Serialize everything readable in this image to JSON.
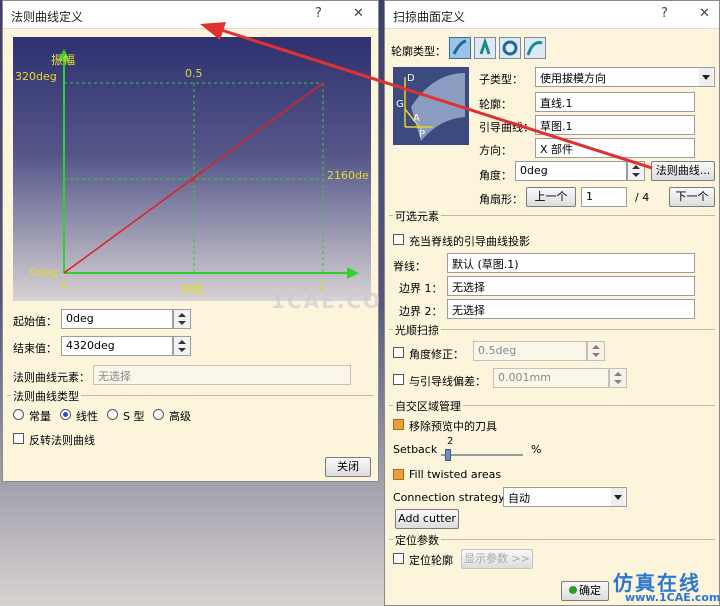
{
  "law": {
    "title": "法则曲线定义",
    "help": "?",
    "close": "✕",
    "graph": {
      "y_axis": "振幅",
      "y_max": "320deg",
      "y_min": "0deg",
      "x_mid": "0.5",
      "mid_right": "2160de",
      "x_min": "0",
      "x_label": "参数",
      "x_max": "1",
      "watermark": "1CAE.CO"
    },
    "start_label": "起始值：",
    "start_value": "0deg",
    "end_label": "结束值：",
    "end_value": "4320deg",
    "element_label": "法则曲线元素：",
    "element_value": "无选择",
    "type_section": "法则曲线类型",
    "types": [
      {
        "label": "常量",
        "checked": false
      },
      {
        "label": "线性",
        "checked": true
      },
      {
        "label": "S 型",
        "checked": false
      },
      {
        "label": "高级",
        "checked": false
      }
    ],
    "reverse_label": "反转法则曲线",
    "close_label": "关闭"
  },
  "sweep": {
    "title": "扫掠曲面定义",
    "help": "?",
    "close": "✕",
    "profile_type_label": "轮廓类型：",
    "icons": [
      "sweep-explicit-icon",
      "sweep-line-icon",
      "sweep-circle-icon",
      "sweep-conic-icon"
    ],
    "diagram": {
      "d": "D",
      "g": "G",
      "a": "A",
      "p": "P"
    },
    "subtype_label": "子类型：",
    "subtype_value": "使用拔模方向",
    "profile_label": "轮廓：",
    "profile_value": "直线.1",
    "guide_label": "引导曲线：",
    "guide_value": "草图.1",
    "direction_label": "方向：",
    "direction_value": "X 部件",
    "angle_label": "角度：",
    "angle_value": "0deg",
    "law_button": "法则曲线...",
    "sector_label": "角扇形：",
    "prev_button": "上一个",
    "sector_value": "1",
    "sector_total": "/ 4",
    "next_button": "下一个",
    "optional_section": "可选元素",
    "spine_projection": "充当脊线的引导曲线投影",
    "spine_label": "脊线：",
    "spine_value": "默认 (草图.1)",
    "boundary1_label": "边界 1：",
    "boundary1_value": "无选择",
    "boundary2_label": "边界 2：",
    "boundary2_value": "无选择",
    "smooth_section": "光顺扫掠",
    "angle_fix_label": "角度修正：",
    "angle_fix_value": "0.5deg",
    "deviation_label": "与引导线偏差：",
    "deviation_value": "0.001mm",
    "self_section": "自交区域管理",
    "remove_preview": "移除预览中的刀具",
    "setback_label": "Setback",
    "setback_value": "2",
    "setback_unit": "%",
    "setback_level": 2,
    "fill_twisted": "Fill twisted areas",
    "strategy_label": "Connection strategy:",
    "strategy_value": "自动",
    "add_cutter": "Add cutter",
    "position_section": "定位参数",
    "position_profile": "定位轮廓",
    "show_params": "显示参数 >>",
    "ok_button": "确定",
    "watermark_cn": "仿真在线",
    "watermark_url": "www.1CAE.com"
  },
  "colors": {
    "dialog_bg": "#fdf4dc",
    "axis": "#30c030",
    "curve": "#e02020",
    "arrow": "#e03030"
  }
}
